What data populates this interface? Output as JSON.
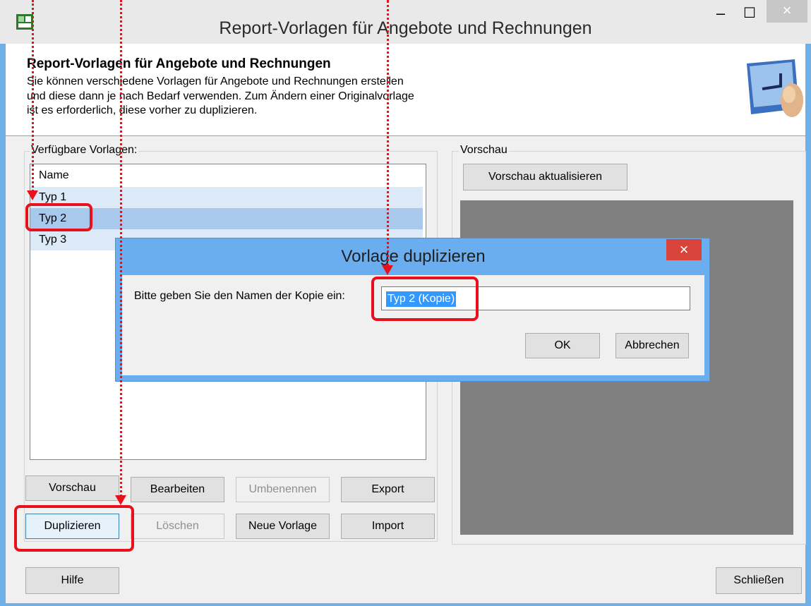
{
  "window": {
    "title": "Report-Vorlagen für Angebote und Rechnungen",
    "minimize_glyph": "–",
    "maximize_glyph": "☐",
    "close_glyph": "×"
  },
  "header": {
    "title": "Report-Vorlagen für Angebote und Rechnungen",
    "description_lines": [
      "Sie können verschiedene Vorlagen für Angebote und Rechnungen erstellen",
      "und diese dann je nach Bedarf verwenden. Zum Ändern einer Originalvorlage",
      "ist es erforderlich, diese vorher zu duplizieren."
    ],
    "icon": "keyboard-enter-key-icon"
  },
  "templates": {
    "group_label": "Verfügbare Vorlagen:",
    "column_header": "Name",
    "items": [
      "Typ 1",
      "Typ 2",
      "Typ 3"
    ],
    "selected": "Typ 2"
  },
  "buttons": {
    "vorschau": "Vorschau",
    "bearbeiten": "Bearbeiten",
    "umbenennen": "Umbenennen",
    "export": "Export",
    "duplizieren": "Duplizieren",
    "loeschen": "Löschen",
    "neue_vorlage": "Neue Vorlage",
    "import": "Import",
    "hilfe": "Hilfe",
    "schliessen": "Schließen"
  },
  "preview": {
    "group_label": "Vorschau",
    "refresh_button": "Vorschau aktualisieren"
  },
  "dialog": {
    "title": "Vorlage duplizieren",
    "close_glyph": "×",
    "prompt": "Bitte geben Sie den Namen der Kopie ein:",
    "input_value": "Typ 2 (Kopie)",
    "ok": "OK",
    "cancel": "Abbrechen"
  },
  "colors": {
    "annotation_red": "#e8101b",
    "selection_blue": "#3399ff",
    "dialog_frame": "#6aaef0",
    "close_red": "#d9443a"
  }
}
